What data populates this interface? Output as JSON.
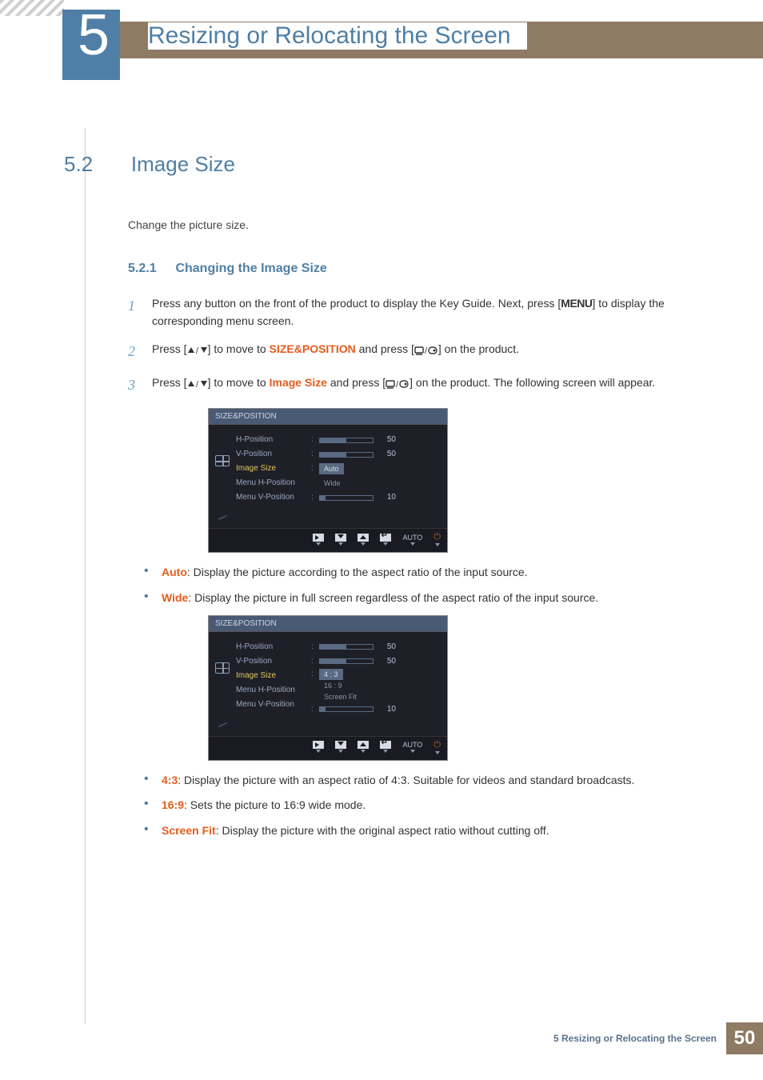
{
  "chapter": {
    "number": "5",
    "title": "Resizing or Relocating the Screen"
  },
  "section": {
    "number": "5.2",
    "title": "Image Size",
    "intro": "Change the picture size."
  },
  "subsection": {
    "number": "5.2.1",
    "title": "Changing the Image Size"
  },
  "steps": {
    "s1": {
      "num": "1",
      "pre": "Press any button on the front of the product to display the Key Guide. Next, press [",
      "key": "MENU",
      "post": "] to display the corresponding menu screen."
    },
    "s2": {
      "num": "2",
      "pre": "Press [",
      "mid1": "] to move to ",
      "term": "SIZE&POSITION",
      "mid2": " and press [",
      "post": "] on the product."
    },
    "s3": {
      "num": "3",
      "pre": "Press [",
      "mid1": "] to move to ",
      "term": "Image Size",
      "mid2": " and press [",
      "post": "] on the product. The following screen will appear."
    }
  },
  "osd": {
    "title": "SIZE&POSITION",
    "rows": {
      "hpos": "H-Position",
      "vpos": "V-Position",
      "imgsize": "Image Size",
      "mhpos": "Menu H-Position",
      "mvpos": "Menu V-Position"
    },
    "vals": {
      "fifty": "50",
      "ten": "10"
    },
    "optsA": {
      "a": "Auto",
      "b": "Wide"
    },
    "optsB": {
      "a": "4 : 3",
      "b": "16 : 9",
      "c": "Screen Fit"
    },
    "nav": {
      "auto": "AUTO"
    }
  },
  "bulletsA": {
    "auto": {
      "term": "Auto",
      "text": ": Display the picture according to the aspect ratio of the input source."
    },
    "wide": {
      "term": "Wide",
      "text": ": Display the picture in full screen regardless of the aspect ratio of the input source."
    }
  },
  "bulletsB": {
    "b43": {
      "term": "4:3",
      "text": ": Display the picture with an aspect ratio of 4:3. Suitable for videos and standard broadcasts."
    },
    "b169": {
      "term": "16:9",
      "text": ": Sets the picture to 16:9 wide mode."
    },
    "bfit": {
      "term": "Screen Fit",
      "text": ": Display the picture with the original aspect ratio without cutting off."
    }
  },
  "footer": {
    "label": "5 Resizing or Relocating the Screen",
    "page": "50"
  }
}
